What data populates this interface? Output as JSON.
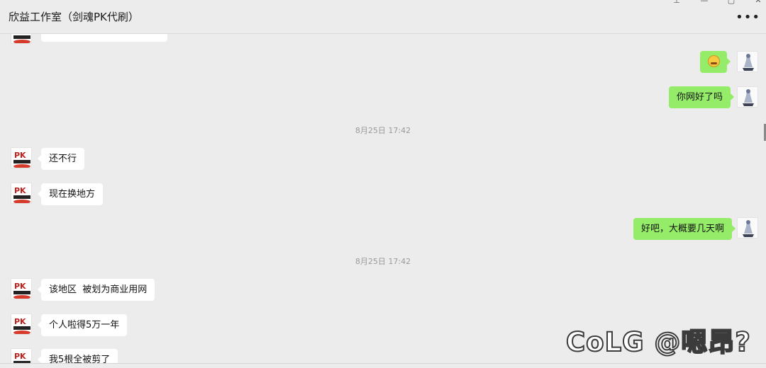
{
  "window": {
    "title": "欣益工作室（剑魂PK代刷）",
    "more_label": "•••",
    "controls": {
      "pin": "⊥",
      "minimize": "—",
      "maximize": "▢",
      "close": "✕"
    }
  },
  "chat": {
    "messages": [
      {
        "side": "right",
        "kind": "emoji",
        "emoji": "grimace-emoji"
      },
      {
        "side": "right",
        "kind": "text",
        "text": "你网好了吗"
      },
      {
        "kind": "time",
        "text": "8月25日 17:42"
      },
      {
        "side": "left",
        "kind": "text",
        "text": "还不行"
      },
      {
        "side": "left",
        "kind": "text",
        "text": "现在换地方"
      },
      {
        "side": "right",
        "kind": "text",
        "text": "好吧，大概要几天啊"
      },
      {
        "kind": "time",
        "text": "8月25日 17:42"
      },
      {
        "side": "left",
        "kind": "text",
        "text": "该地区  被划为商业用网"
      },
      {
        "side": "left",
        "kind": "text",
        "text": "个人啦得5万一年"
      },
      {
        "side": "left",
        "kind": "text",
        "text": "我5根全被剪了"
      }
    ]
  },
  "watermark": {
    "text": "CoLG @嗯昂?"
  },
  "colors": {
    "bubble_self": "#95ec69",
    "bubble_other": "#ffffff",
    "background": "#ececec"
  }
}
